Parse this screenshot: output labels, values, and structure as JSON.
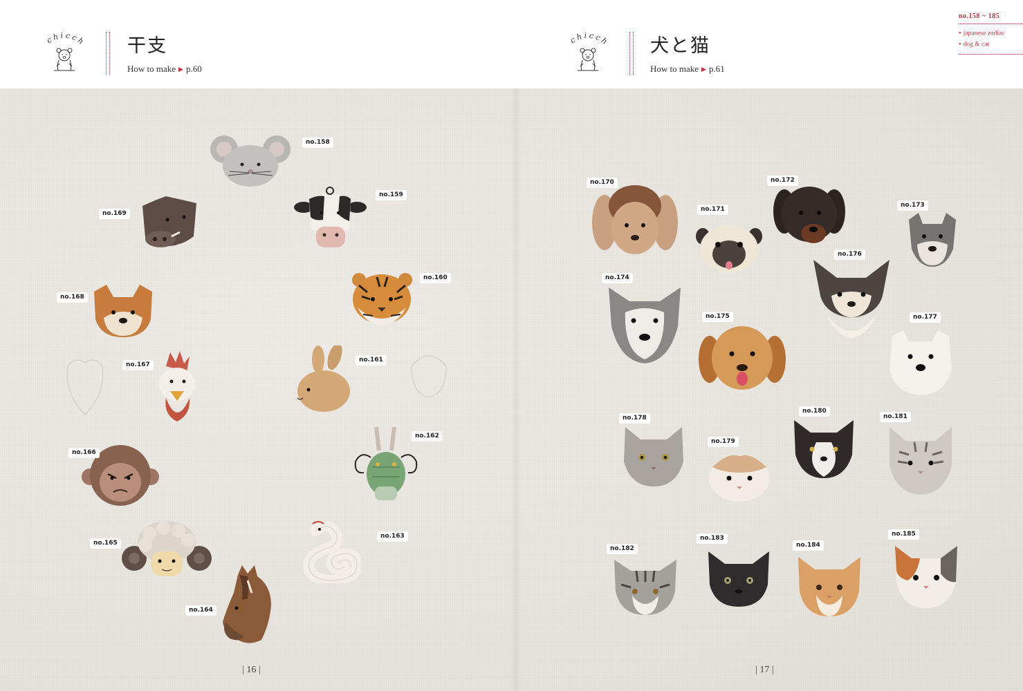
{
  "left_page": {
    "logo_text": "chicchi",
    "title": "干支",
    "howto_label": "How to make",
    "howto_page": "p.60",
    "page_number": "16"
  },
  "right_page": {
    "logo_text": "chicchi",
    "title": "犬と猫",
    "howto_label": "How to make",
    "howto_page": "p.61",
    "page_number": "17"
  },
  "index_tab": {
    "range": "no.158 ~ 185",
    "items": [
      "japanese zodiac",
      "dog & cat"
    ]
  },
  "labels": {
    "l158": "no.158",
    "l159": "no.159",
    "l160": "no.160",
    "l161": "no.161",
    "l162": "no.162",
    "l163": "no.163",
    "l164": "no.164",
    "l165": "no.165",
    "l166": "no.166",
    "l167": "no.167",
    "l168": "no.168",
    "l169": "no.169",
    "l170": "no.170",
    "l171": "no.171",
    "l172": "no.172",
    "l173": "no.173",
    "l174": "no.174",
    "l175": "no.175",
    "l176": "no.176",
    "l177": "no.177",
    "l178": "no.178",
    "l179": "no.179",
    "l180": "no.180",
    "l181": "no.181",
    "l182": "no.182",
    "l183": "no.183",
    "l184": "no.184",
    "l185": "no.185"
  },
  "colors": {
    "accent": "#c0333d",
    "background_linen": "#e9e6e1",
    "header_white": "#ffffff"
  }
}
